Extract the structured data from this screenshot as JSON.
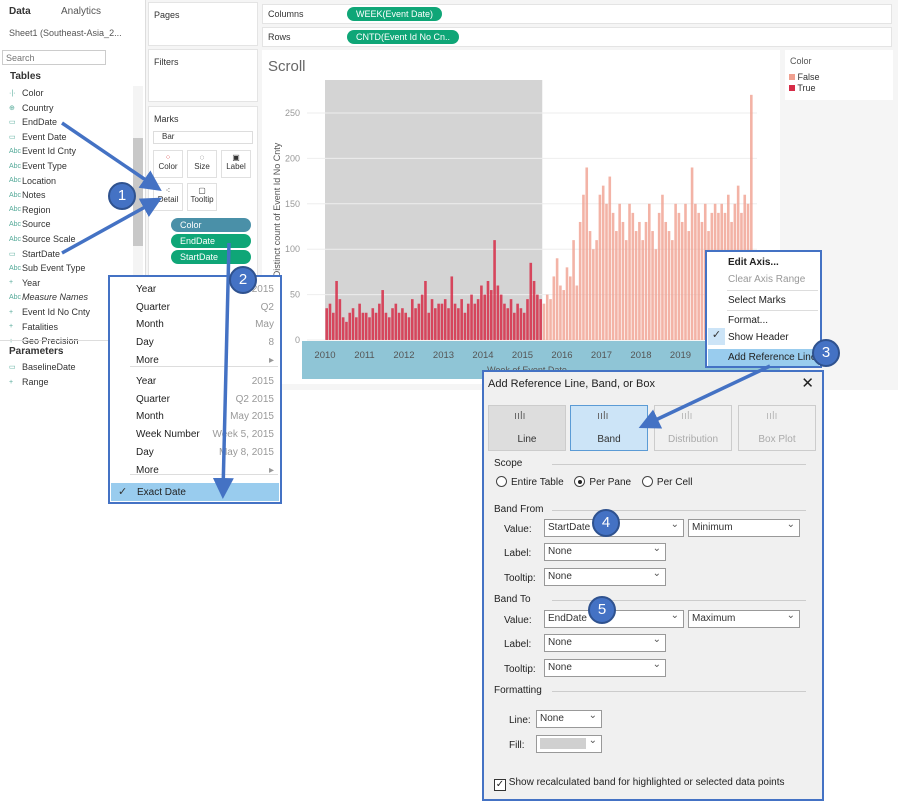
{
  "left_panel": {
    "tab_data": "Data",
    "tab_analytics": "Analytics",
    "datasource": "Sheet1 (Southeast-Asia_2...",
    "search_placeholder": "Search",
    "tables_header": "Tables",
    "fields": [
      "Color",
      "Country",
      "EndDate",
      "Event Date",
      "Event Id Cnty",
      "Event Type",
      "Location",
      "Notes",
      "Region",
      "Source",
      "Source Scale",
      "StartDate",
      "Sub Event Type",
      "Year",
      "Measure Names",
      "Event Id No Cnty",
      "Fatalities",
      "Geo Precision"
    ],
    "parameters_header": "Parameters",
    "parameters": [
      "BaselineDate",
      "Range"
    ]
  },
  "shelves": {
    "pages": "Pages",
    "filters": "Filters",
    "marks": "Marks",
    "mark_type": "Bar",
    "columns_label": "Columns",
    "rows_label": "Rows",
    "columns_pill": "WEEK(Event Date)",
    "rows_pill": "CNTD(Event Id No Cn..",
    "cards": [
      "Color",
      "Size",
      "Label",
      "Detail",
      "Tooltip"
    ],
    "mark_pills": [
      "Color",
      "EndDate",
      "StartDate"
    ]
  },
  "sheet": {
    "title": "Scroll"
  },
  "legend": {
    "title": "Color",
    "items": [
      {
        "label": "False",
        "color": "#f0a090"
      },
      {
        "label": "True",
        "color": "#d62b47"
      }
    ]
  },
  "chart_data": {
    "type": "bar",
    "xlabel": "Week of Event Date",
    "ylabel": "Distinct count of Event Id No Cnty",
    "ylim": [
      0,
      285
    ],
    "yticks": [
      0,
      50,
      100,
      150,
      200,
      250
    ],
    "xticks": [
      "2010",
      "2011",
      "2012",
      "2013",
      "2014",
      "2015",
      "2016",
      "2017",
      "2018",
      "2019"
    ],
    "band": {
      "from": "2010-01",
      "to": "2015-07",
      "color": "#d4d4d4"
    },
    "true_until": "2015-07",
    "start": "2010-01",
    "values": [
      35,
      40,
      30,
      65,
      45,
      25,
      20,
      30,
      35,
      25,
      40,
      30,
      30,
      25,
      35,
      30,
      40,
      55,
      30,
      25,
      35,
      40,
      30,
      35,
      30,
      25,
      45,
      35,
      40,
      50,
      65,
      30,
      45,
      35,
      40,
      40,
      45,
      35,
      70,
      40,
      35,
      45,
      30,
      40,
      50,
      40,
      45,
      60,
      50,
      65,
      55,
      110,
      60,
      50,
      40,
      35,
      45,
      30,
      40,
      35,
      30,
      45,
      85,
      65,
      50,
      45,
      40,
      50,
      45,
      70,
      90,
      60,
      55,
      80,
      70,
      110,
      60,
      130,
      160,
      190,
      120,
      100,
      110,
      160,
      170,
      150,
      180,
      140,
      120,
      150,
      130,
      110,
      150,
      140,
      120,
      130,
      110,
      130,
      150,
      120,
      100,
      140,
      160,
      130,
      120,
      110,
      150,
      140,
      130,
      150,
      120,
      190,
      150,
      140,
      130,
      150,
      120,
      140,
      150,
      140,
      150,
      140,
      160,
      130,
      150,
      170,
      140,
      160,
      150,
      270
    ]
  },
  "date_menu": {
    "items1": [
      {
        "label": "Year",
        "value": "2015"
      },
      {
        "label": "Quarter",
        "value": "Q2"
      },
      {
        "label": "Month",
        "value": "May"
      },
      {
        "label": "Day",
        "value": "8"
      },
      {
        "label": "More",
        "value": "▸"
      }
    ],
    "items2": [
      {
        "label": "Year",
        "value": "2015"
      },
      {
        "label": "Quarter",
        "value": "Q2 2015"
      },
      {
        "label": "Month",
        "value": "May 2015"
      },
      {
        "label": "Week Number",
        "value": "Week 5, 2015"
      },
      {
        "label": "Day",
        "value": "May 8, 2015"
      },
      {
        "label": "More",
        "value": "▸"
      }
    ],
    "selected": "Exact Date"
  },
  "axis_menu": {
    "edit": "Edit Axis...",
    "clear": "Clear Axis Range",
    "select": "Select Marks",
    "format": "Format...",
    "show_header": "Show Header",
    "add_ref": "Add Reference Line"
  },
  "dialog": {
    "title": "Add Reference Line, Band, or Box",
    "types": [
      "Line",
      "Band",
      "Distribution",
      "Box Plot"
    ],
    "scope_label": "Scope",
    "scope_options": [
      "Entire Table",
      "Per Pane",
      "Per Cell"
    ],
    "scope_selected": "Per Pane",
    "band_from": "Band From",
    "band_to": "Band To",
    "value_label": "Value:",
    "label_label": "Label:",
    "tooltip_label": "Tooltip:",
    "from_value": "StartDate",
    "from_agg": "Minimum",
    "from_label": "None",
    "from_tooltip": "None",
    "to_value": "EndDate",
    "to_agg": "Maximum",
    "to_label": "None",
    "to_tooltip": "None",
    "formatting": "Formatting",
    "line_label": "Line:",
    "line_value": "None",
    "fill_label": "Fill:",
    "fill_color": "#d0d0d0",
    "checkbox_label": "Show recalculated band for highlighted or selected data points",
    "checkbox_checked": true
  },
  "callouts": [
    "1",
    "2",
    "3",
    "4",
    "5"
  ],
  "colors": {
    "accent": "#4472c4",
    "pill": "#0fa677",
    "axis_band": "#8fc5d6"
  }
}
